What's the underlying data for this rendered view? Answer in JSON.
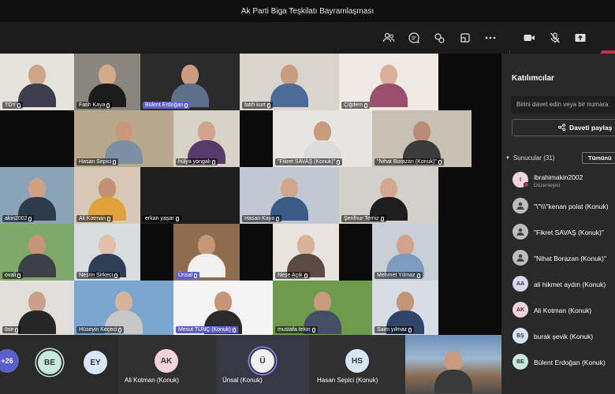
{
  "window": {
    "title": "Ak Parti Biga Teşkilatı Bayramlaşması"
  },
  "toolbar": {
    "icons": [
      "people-icon",
      "chat-icon",
      "reactions-icon",
      "rooms-icon",
      "more-icon",
      "camera-icon",
      "mic-off-icon",
      "share-icon",
      "leave-icon"
    ]
  },
  "grid": {
    "tiles": [
      {
        "name": "TOY"
      },
      {
        "name": "Fatih Kaya"
      },
      {
        "name": "Bülent Erdoğan"
      },
      {
        "name": "fatih kurt"
      },
      {
        "name": "Çiğdem"
      },
      {
        "name": "Hasan Sepici"
      },
      {
        "name": "hülya yongalı"
      },
      {
        "name": "\"Fikret SAVAŞ (Konuk)\""
      },
      {
        "name": "\"Nihat Borazan (Konuk)\""
      },
      {
        "name": "akin2002"
      },
      {
        "name": "Ali Kotman"
      },
      {
        "name": "erkan yaşar"
      },
      {
        "name": "Hasan Kaya"
      },
      {
        "name": "Şerifnur Temiz"
      },
      {
        "name": "ovali"
      },
      {
        "name": "Nesrin Sirkeci"
      },
      {
        "name": "Ünsal"
      },
      {
        "name": "Neşe Açık"
      },
      {
        "name": "Mehmet Yılmaz"
      },
      {
        "name": "öse"
      },
      {
        "name": "Hüseyin Keçeci"
      },
      {
        "name": "Mesut TUNÇ (Konuk)"
      },
      {
        "name": "mustafa tekin"
      },
      {
        "name": "Saim yılmaz"
      }
    ]
  },
  "strip": {
    "overflow": "+26",
    "avatars": [
      {
        "initials": "BE",
        "color": "#c7e8dc"
      },
      {
        "initials": "EY",
        "color": "#d8e7f7"
      }
    ],
    "cells": [
      {
        "initials": "AK",
        "name": "Ali Kotman (Konuk)",
        "color": "#f4d2db"
      },
      {
        "initials": "Ü",
        "name": "Ünsal (Konuk)",
        "color": "#f0f0f0"
      },
      {
        "initials": "HS",
        "name": "Hasan Sepici (Konuk)",
        "color": "#d7e6f7"
      }
    ]
  },
  "panel": {
    "title": "Katılımcılar",
    "search_placeholder": "Birini davet edin veya bir numara",
    "share_label": "Daveti paylaş",
    "section_label": "Sunucular (31)",
    "all_button": "Tümünü",
    "participants": [
      {
        "initials": "I",
        "name": "ibrahimakin2002",
        "sub": "Düzenleyici",
        "color": "#f4d2db",
        "presence": true
      },
      {
        "initials": "",
        "name": "\"\\\"\\\\\\\"kenan polat (Konuk)",
        "sub": "",
        "color": "#bdbdbd"
      },
      {
        "initials": "",
        "name": "\"Fikret SAVAŞ (Konuk)\"",
        "sub": "",
        "color": "#bdbdbd"
      },
      {
        "initials": "",
        "name": "\"Nihat Borazan (Konuk)\"",
        "sub": "",
        "color": "#bdbdbd"
      },
      {
        "initials": "AA",
        "name": "ali hikmet aydın (Konuk)",
        "sub": "",
        "color": "#ddd5f3"
      },
      {
        "initials": "AK",
        "name": "Ali Kotman (Konuk)",
        "sub": "",
        "color": "#f4d2db"
      },
      {
        "initials": "BŞ",
        "name": "burak şevik (Konuk)",
        "sub": "",
        "color": "#d7e6f7"
      },
      {
        "initials": "BE",
        "name": "Bülent Erdoğan (Konuk)",
        "sub": "",
        "color": "#c7e8dc"
      }
    ]
  },
  "colors": {
    "accent": "#5b5fc7",
    "leave": "#c4314b"
  }
}
